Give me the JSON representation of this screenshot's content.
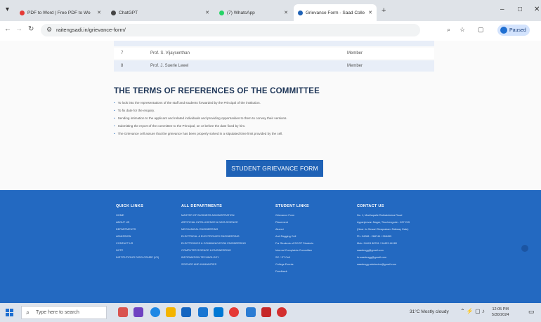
{
  "browser": {
    "tabs": [
      {
        "label": "PDF to Word | Free PDF to Wo",
        "active": false
      },
      {
        "label": "ChatGPT",
        "active": false
      },
      {
        "label": "(7) WhatsApp",
        "active": false
      },
      {
        "label": "Grievance Form - Saad Colle",
        "active": true
      }
    ],
    "url": "raitengsadi.in/grievance-form/",
    "profile_label": "Paused",
    "window_controls": {
      "minimize": "–",
      "maximize": "□",
      "close": "✕"
    }
  },
  "committee_table": {
    "rows": [
      {
        "sno": "7",
        "name": "Prof. S. Vijaysenthan",
        "role": "Member"
      },
      {
        "sno": "8",
        "name": "Prof. J. Suerle Leeel",
        "role": "Member"
      }
    ]
  },
  "terms": {
    "heading": "THE TERMS OF REFERENCES OF THE COMMITTEE",
    "items": [
      "To look into the representations of the staff and students forwarded by the Principal of the institution.",
      "To fix date for the enquiry.",
      "Sending intimation to the applicant and related individuals and providing opportunities to them to convey their versions.",
      "Submitting the report of the committee to the Principal, on or before the date fixed by him.",
      "The Grievance cell assure that the grievance has been properly solved in a stipulated time limit provided by the cell."
    ]
  },
  "form_button_label": "STUDENT GRIEVANCE FORM",
  "footer": {
    "quick_links": {
      "heading": "QUICK LINKS",
      "items": [
        "HOME",
        "ABOUT US",
        "DEPARTMENTS",
        "ADMISSION",
        "CONTACT US",
        "NCTE",
        "INSTITUTION'S DISCLOSURE (ICI)"
      ]
    },
    "all_departments": {
      "heading": "ALL DEPARTMENTS",
      "items": [
        "MASTER OF BUSINESS ADMINISTRATION",
        "ARTIFICIAL INTELLIGENCE & DATA SCIENCE",
        "MECHANICAL ENGINEERING",
        "ELECTRICAL & ELECTRONICS ENGINEERING",
        "ELECTRONICS & COMMUNICATION ENGINEERING",
        "COMPUTER SCIENCE & ENGINEERING",
        "INFORMATION TECHNOLOGY",
        "SCIENCE AND HUMANITIES"
      ]
    },
    "student_links": {
      "heading": "STUDENT LINKS",
      "items": [
        "Grievance Form",
        "Placement",
        "Alumni",
        "Anti Ragging Cell",
        "For Students of SC/ST Students",
        "Internal Complaints Committee",
        "SC / ST Cell",
        "College Events",
        "Feedback"
      ]
    },
    "contact_us": {
      "heading": "CONTACT US",
      "items": [
        "No. 1, Madhapalle Rathakrishna Road",
        "Ayyanjeevan Nagar, Tiruchengode - 637 215",
        "(Near: to Sewari Sivaprakam Railway Gate)",
        "Ph: 04288 - 268744 / 268455",
        "Mob: 94424 88761 / 94433 44180",
        "saadengg@gmail.com",
        "hr.saadengg@gmail.com",
        "saadengg.admission@gmail.com"
      ]
    }
  },
  "taskbar": {
    "search_placeholder": "Type here to search",
    "weather": "31°C  Mostly cloudy",
    "time": "12:05 PM",
    "date": "5/30/2024"
  },
  "colors": {
    "footer_bg": "#2369c1",
    "button_bg": "#1f62b6",
    "heading": "#1d3557"
  }
}
